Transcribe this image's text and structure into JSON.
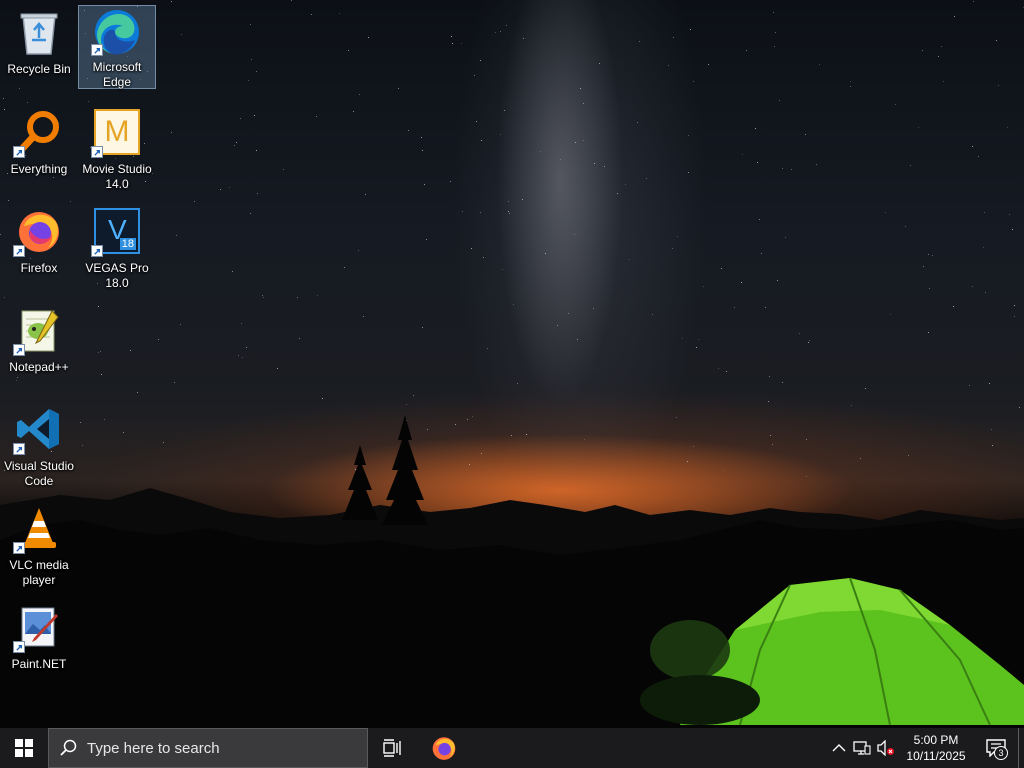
{
  "desktop": {
    "icons": [
      {
        "label": "Recycle Bin",
        "icon": "recycle-bin-icon",
        "shortcut": false,
        "selected": false
      },
      {
        "label": "Microsoft Edge",
        "icon": "edge-icon",
        "shortcut": true,
        "selected": true
      },
      {
        "label": "Everything",
        "icon": "everything-icon",
        "shortcut": true,
        "selected": false
      },
      {
        "label": "Movie Studio 14.0",
        "icon": "movie-studio-icon",
        "shortcut": true,
        "selected": false
      },
      {
        "label": "Firefox",
        "icon": "firefox-icon",
        "shortcut": true,
        "selected": false
      },
      {
        "label": "VEGAS Pro 18.0",
        "icon": "vegas-pro-icon",
        "shortcut": true,
        "selected": false
      },
      {
        "label": "Notepad++",
        "icon": "notepadpp-icon",
        "shortcut": true,
        "selected": false
      },
      {
        "label": "Visual Studio Code",
        "icon": "vscode-icon",
        "shortcut": true,
        "selected": false
      },
      {
        "label": "VLC media player",
        "icon": "vlc-icon",
        "shortcut": true,
        "selected": false
      },
      {
        "label": "Paint.NET",
        "icon": "paintnet-icon",
        "shortcut": true,
        "selected": false
      }
    ],
    "movie_studio_letter": "M",
    "vegas_letter": "V",
    "vegas_version": "18"
  },
  "taskbar": {
    "search_placeholder": "Type here to search",
    "pinned_apps": [
      "Firefox"
    ],
    "clock_time": "5:00 PM",
    "clock_date": "10/11/2025",
    "notification_count": "3",
    "colors": {
      "taskbar": "#1b1b1d",
      "search_box": "#3a3a3d",
      "accent": "#ffffff"
    }
  }
}
